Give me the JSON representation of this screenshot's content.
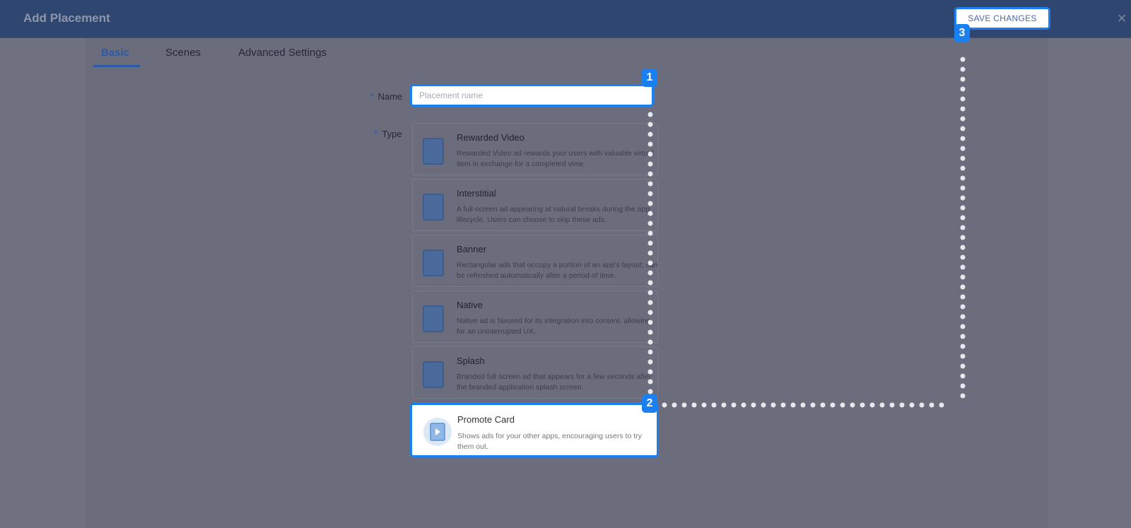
{
  "header": {
    "title": "Add Placement",
    "save_label": "SAVE CHANGES",
    "close_icon": "×"
  },
  "tabs": [
    {
      "label": "Basic",
      "active": true
    },
    {
      "label": "Scenes",
      "active": false
    },
    {
      "label": "Advanced Settings",
      "active": false
    }
  ],
  "form": {
    "name_label": "Name",
    "name_placeholder": "Placement name",
    "type_label": "Type",
    "required_mark": "*"
  },
  "types": [
    {
      "title": "Rewarded Video",
      "desc": "Rewarded Video ad rewards your users with valuable virtual item in exchange for a completed view.",
      "icon": "trophy-icon"
    },
    {
      "title": "Interstitial",
      "desc": "A full-screen ad appearing at natural breaks during the app lifecycle. Users can choose to skip these ads.",
      "icon": "play-icon"
    },
    {
      "title": "Banner",
      "desc": "Rectangular ads that occupy a portion of an app's layout; can be refreshed automatically after a period of time.",
      "icon": "banner-icon"
    },
    {
      "title": "Native",
      "desc": "Native ad is favored for its integration into content, allowing for an uninterrupted UX.",
      "icon": "image-icon"
    },
    {
      "title": "Splash",
      "desc": "Branded full screen ad that appears for a few seconds after the branded application splash screen.",
      "icon": "splash-icon"
    },
    {
      "title": "Promote Card",
      "desc": "Shows ads for your other apps, encouraging users to try them out.",
      "icon": "promote-card-icon"
    }
  ],
  "steps": [
    "1",
    "2",
    "3"
  ],
  "colors": {
    "accent": "#1a7ff0",
    "header": "#2f4670",
    "overlay": "#6f7080"
  }
}
